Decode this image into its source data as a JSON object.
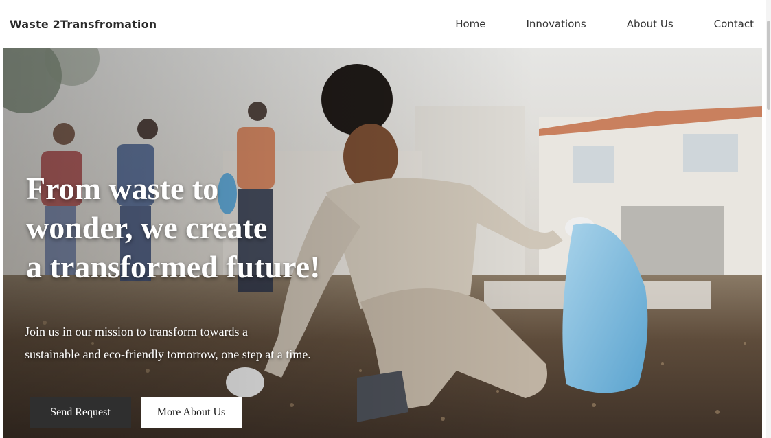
{
  "navbar": {
    "brand": "Waste 2Transfromation",
    "links": [
      {
        "label": "Home"
      },
      {
        "label": "Innovations"
      },
      {
        "label": "About Us"
      },
      {
        "label": "Contact"
      }
    ]
  },
  "hero": {
    "headline_lines": [
      "From waste to",
      "wonder, we create",
      "a transformed future!"
    ],
    "subtext_lines": [
      "Join us in our mission to transform towards a",
      "sustainable and eco-friendly tomorrow, one step at a time."
    ],
    "primary_button": "Send Request",
    "secondary_button": "More About Us",
    "image_subject": "child-picking-up-litter-photo"
  },
  "colors": {
    "primary_button_bg": "#2f2f2f",
    "secondary_button_bg": "#ffffff",
    "headline_text": "#ffffff"
  }
}
